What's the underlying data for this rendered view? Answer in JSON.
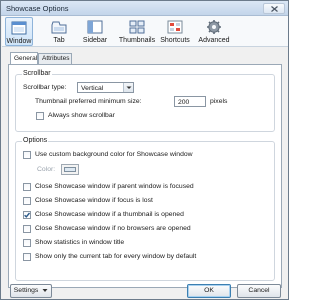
{
  "window": {
    "title": "Showcase Options"
  },
  "toolbar": {
    "items": [
      {
        "label": "Window",
        "icon": "window-icon",
        "active": true
      },
      {
        "label": "Tab",
        "icon": "tab-icon"
      },
      {
        "label": "Sidebar",
        "icon": "sidebar-icon"
      },
      {
        "label": "Thumbnails",
        "icon": "thumbnails-icon"
      },
      {
        "label": "Shortcuts",
        "icon": "shortcuts-icon"
      },
      {
        "label": "Advanced",
        "icon": "gear-icon"
      }
    ]
  },
  "tabs": [
    {
      "label": "General",
      "active": true
    },
    {
      "label": "Attributes"
    }
  ],
  "scrollbar": {
    "title": "Scrollbar",
    "type_label": "Scrollbar type:",
    "type_value": "Vertical",
    "min_size_label": "Thumbnail preferred minimum size:",
    "min_size_value": "200",
    "min_size_unit": "pixels",
    "always_show_label": "Always show scrollbar"
  },
  "options": {
    "title": "Options",
    "custom_bg_label": "Use custom background color for Showcase window",
    "color_label": "Color:",
    "items": [
      {
        "label": "Close Showcase window if parent window is focused",
        "checked": false
      },
      {
        "label": "Close Showcase window if focus is lost",
        "checked": false
      },
      {
        "label": "Close Showcase window if a thumbnail is opened",
        "checked": true
      },
      {
        "label": "Close Showcase window if no browsers are opened",
        "checked": false
      },
      {
        "label": "Show statistics in window title",
        "checked": false
      },
      {
        "label": "Show only the current tab for every window by default",
        "checked": false
      }
    ]
  },
  "footer": {
    "settings_label": "Settings",
    "ok_label": "OK",
    "cancel_label": "Cancel"
  },
  "colors": {
    "accent": "#3c7fb1",
    "check": "#2c5a8a"
  }
}
